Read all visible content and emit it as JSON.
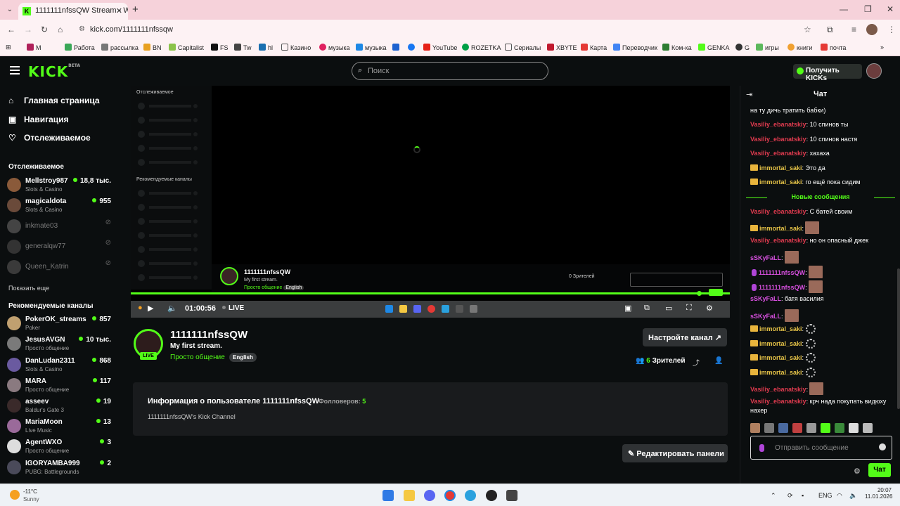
{
  "browser": {
    "tab_title": "1111111nfssQW Stream - Watc",
    "tab_close": "✕",
    "new_tab": "+",
    "url": "kick.com/1111111nfssqw",
    "bookmarks": [
      "M",
      "Работа",
      "рассылка",
      "BN",
      "Capitalist",
      "FS",
      "Tw",
      "hl",
      "Казино",
      "музыка",
      "музыка",
      "",
      "YouTube",
      "ROZETKA",
      "Сериалы",
      "XBYTE",
      "Карта",
      "Переводчик",
      "Ком-ка",
      "GENKA",
      "G",
      "игры",
      "книги",
      "почта"
    ]
  },
  "header": {
    "search_placeholder": "Поиск",
    "get_kicks": "Получить KICKs",
    "logo": "KICK",
    "logo_beta": "BETA"
  },
  "sidebar": {
    "nav": [
      {
        "label": "Главная страница",
        "icon": "home-icon"
      },
      {
        "label": "Навигация",
        "icon": "compass-icon"
      },
      {
        "label": "Отслеживаемое",
        "icon": "heart-icon"
      }
    ],
    "following_title": "Отслеживаемое",
    "following": [
      {
        "name": "Mellstroy987",
        "category": "Slots & Casino",
        "viewers": "18,8 тыс.",
        "online": true
      },
      {
        "name": "magicaldota",
        "category": "Slots & Casino",
        "viewers": "955",
        "online": true
      },
      {
        "name": "inkmate03",
        "category": "",
        "viewers": "",
        "online": false
      },
      {
        "name": "generalqw77",
        "category": "",
        "viewers": "",
        "online": false
      },
      {
        "name": "Queen_Katrin",
        "category": "",
        "viewers": "",
        "online": false
      }
    ],
    "show_more": "Показать еще",
    "recommended_title": "Рекомендуемые каналы",
    "recommended": [
      {
        "name": "PokerOK_streams",
        "category": "Poker",
        "viewers": "857"
      },
      {
        "name": "JesusAVGN",
        "category": "Просто общение",
        "viewers": "10 тыс."
      },
      {
        "name": "DanLudan2311",
        "category": "Slots & Casino",
        "viewers": "868"
      },
      {
        "name": "MARA",
        "category": "Просто общение",
        "viewers": "117"
      },
      {
        "name": "asseev",
        "category": "Baldur's Gate 3",
        "viewers": "19"
      },
      {
        "name": "MariaMoon",
        "category": "Live Music",
        "viewers": "13"
      },
      {
        "name": "AgentWXO",
        "category": "Просто общение",
        "viewers": "3"
      },
      {
        "name": "IGORYAMBA999",
        "category": "PUBG: Battlegrounds",
        "viewers": "2"
      }
    ]
  },
  "player": {
    "ghost_following": "Отслеживаемое",
    "ghost_recommended": "Рекомендуемые каналы",
    "inner_name": "1111111nfssQW",
    "inner_stream": "My first stream.",
    "inner_category": "Просто общение",
    "inner_tag": "English",
    "inner_viewers": "0 Зрителей",
    "time": "01:00:56",
    "live": "LIVE"
  },
  "channel": {
    "name": "1111111nfssQW",
    "stream_title": "My first stream.",
    "category": "Просто общение",
    "tag": "English",
    "live_badge": "LIVE",
    "setup_button": "Настройте канал",
    "viewers_count": "6",
    "viewers_label": "Зрителей",
    "about_title": "Информация о пользователе 1111111nfssQW",
    "followers_label": "Фолловеров:",
    "followers_count": "5",
    "about_desc": "1111111nfssQW's Kick Channel",
    "edit_panels": "Редактировать панели"
  },
  "chat": {
    "title": "Чат",
    "new_messages": "Новые сообщения",
    "input_placeholder": "Отправить сообщение",
    "send": "Чат",
    "messages": [
      {
        "user": "",
        "text": "на ту дичь тратить бабки)",
        "color": "red"
      },
      {
        "user": "Vasiliy_ebanatskiy",
        "text": ": 10 спинов ты",
        "color": "red"
      },
      {
        "user": "Vasiliy_ebanatskiy",
        "text": ": 10 спинов настя",
        "color": "red"
      },
      {
        "user": "Vasiliy_ebanatskiy",
        "text": ": хахаха",
        "color": "red"
      },
      {
        "user": "immortal_saki",
        "text": ": Это да",
        "color": "yel"
      },
      {
        "user": "immortal_saki",
        "text": ": го ещё пока сидим",
        "color": "yel"
      }
    ],
    "messages2": [
      {
        "user": "Vasiliy_ebanatskiy",
        "text": ": С батей своим",
        "color": "red"
      },
      {
        "user": "immortal_saki",
        "text": ":",
        "color": "yel"
      },
      {
        "user": "Vasiliy_ebanatskiy",
        "text": ": но он опасный джек",
        "color": "red"
      },
      {
        "user": "sSKyFaLL",
        "text": ":",
        "color": "mag"
      },
      {
        "user": "1111111nfssQW",
        "text": ":",
        "color": "mag"
      },
      {
        "user": "1111111nfssQW",
        "text": ":",
        "color": "mag"
      },
      {
        "user": "sSKyFaLL",
        "text": ": батя василия",
        "color": "mag"
      },
      {
        "user": "sSKyFaLL",
        "text": ":",
        "color": "mag"
      },
      {
        "user": "immortal_saki",
        "text": ":",
        "color": "yel"
      },
      {
        "user": "immortal_saki",
        "text": ":",
        "color": "yel"
      },
      {
        "user": "immortal_saki",
        "text": ":",
        "color": "yel"
      },
      {
        "user": "immortal_saki",
        "text": ":",
        "color": "yel"
      },
      {
        "user": "Vasiliy_ebanatskiy",
        "text": ":",
        "color": "red"
      },
      {
        "user": "Vasiliy_ebanatskiy",
        "text": ": крч нада покупать видюху",
        "color": "red"
      },
      {
        "user": "",
        "text": "нахер",
        "color": "red"
      }
    ]
  },
  "taskbar": {
    "temp": "-11°C",
    "weather": "Sunny",
    "lang": "ENG",
    "time": "20:07",
    "date": "11.01.2026"
  },
  "colors": {
    "accent": "#53fc18",
    "bg": "#0b0e0f",
    "panel": "#191b1d"
  }
}
